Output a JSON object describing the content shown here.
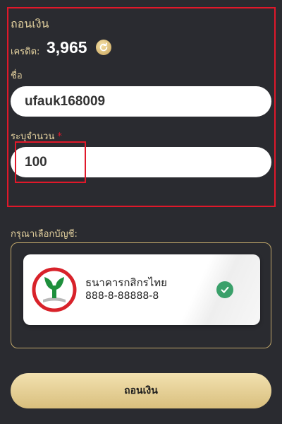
{
  "form": {
    "title": "ถอนเงิน",
    "credit_label": "เครดิต:",
    "credit_value": "3,965",
    "name_label": "ชื่อ",
    "name_value": "ufauk168009",
    "amount_label": "ระบุจำนวน",
    "required_mark": "*",
    "amount_value": "100"
  },
  "account": {
    "choose_label": "กรุณาเลือกบัญชี:",
    "bank_name": "ธนาคารกสิกรไทย",
    "account_number": "888-8-88888-8",
    "selected": true
  },
  "actions": {
    "withdraw_label": "ถอนเงิน"
  },
  "icons": {
    "refresh": "refresh-icon",
    "bank": "kasikorn-logo-icon",
    "check": "check-icon"
  },
  "colors": {
    "background": "#2a2b30",
    "gold": "#d9bf7d",
    "highlight": "#e0182a",
    "check": "#3aa06a"
  }
}
